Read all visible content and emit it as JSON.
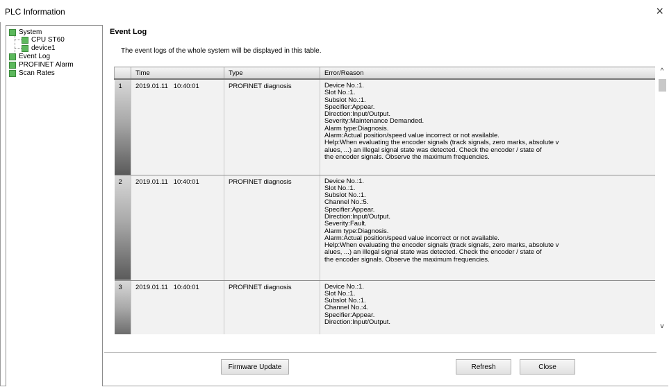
{
  "window": {
    "title": "PLC Information",
    "close_glyph": "×"
  },
  "tree": {
    "system": "System",
    "cpu": "CPU ST60",
    "device": "device1",
    "event_log": "Event Log",
    "profinet_alarm": "PROFINET Alarm",
    "scan_rates": "Scan Rates"
  },
  "panel": {
    "title": "Event Log",
    "description": "The event logs of the whole system will be displayed in this table."
  },
  "table": {
    "headers": {
      "time": "Time",
      "type": "Type",
      "reason": "Error/Reason"
    },
    "rows": [
      {
        "index": "1",
        "time": "2019.01.11   10:40:01",
        "type": "PROFINET diagnosis",
        "reason": [
          "Device No.:1.",
          "Slot No.:1.",
          "Subslot No.:1.",
          "Specifier:Appear.",
          "Direction:Input/Output.",
          "Severity:Maintenance Demanded.",
          "Alarm type:Diagnosis.",
          "Alarm:Actual position/speed value incorrect or not available.",
          "Help:When evaluating the encoder signals (track signals, zero marks, absolute v",
          "alues, ...) an illegal signal state was detected. Check the encoder / state of",
          "the encoder signals. Observe the maximum frequencies."
        ]
      },
      {
        "index": "2",
        "time": "2019.01.11   10:40:01",
        "type": "PROFINET diagnosis",
        "reason": [
          "Device No.:1.",
          "Slot No.:1.",
          "Subslot No.:1.",
          "Channel No.:5.",
          "Specifier:Appear.",
          "Direction:Input/Output.",
          "Severity:Fault.",
          "Alarm type:Diagnosis.",
          "Alarm:Actual position/speed value incorrect or not available.",
          "Help:When evaluating the encoder signals (track signals, zero marks, absolute v",
          "alues, ...) an illegal signal state was detected. Check the encoder / state of",
          "the encoder signals. Observe the maximum frequencies."
        ]
      },
      {
        "index": "3",
        "time": "2019.01.11   10:40:01",
        "type": "PROFINET diagnosis",
        "reason": [
          "Device No.:1.",
          "Slot No.:1.",
          "Subslot No.:1.",
          "Channel No.:4.",
          "Specifier:Appear.",
          "Direction:Input/Output."
        ]
      }
    ]
  },
  "buttons": {
    "firmware_update": "Firmware Update",
    "refresh": "Refresh",
    "close": "Close"
  },
  "scrollbar": {
    "up": "^",
    "down": "v"
  }
}
